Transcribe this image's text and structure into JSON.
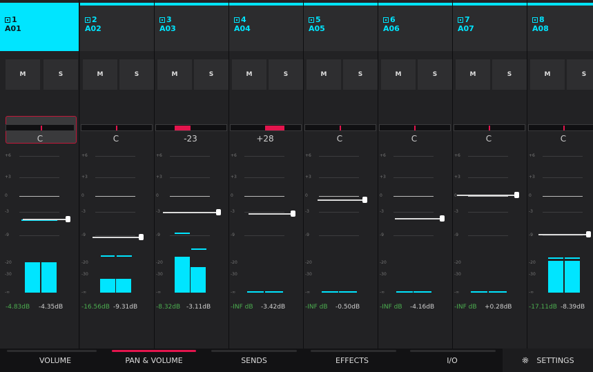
{
  "strips": [
    {
      "num": "1",
      "name": "A01",
      "pan": "C",
      "db_left": "-4.83dB",
      "db_right": "-4.35dB",
      "selected": true,
      "pan_type": "center"
    },
    {
      "num": "2",
      "name": "A02",
      "pan": "C",
      "db_left": "-16.56dB",
      "db_right": "-9.31dB",
      "selected": false,
      "pan_type": "center"
    },
    {
      "num": "3",
      "name": "A03",
      "pan": "-23",
      "db_left": "-8.32dB",
      "db_right": "-3.11dB",
      "selected": false,
      "pan_type": "left"
    },
    {
      "num": "4",
      "name": "A04",
      "pan": "+28",
      "db_left": "-INF dB",
      "db_right": "-3.42dB",
      "selected": false,
      "pan_type": "right"
    },
    {
      "num": "5",
      "name": "A05",
      "pan": "C",
      "db_left": "-INF dB",
      "db_right": "-0.50dB",
      "selected": false,
      "pan_type": "center"
    },
    {
      "num": "6",
      "name": "A06",
      "pan": "C",
      "db_left": "-INF dB",
      "db_right": "-4.16dB",
      "selected": false,
      "pan_type": "center"
    },
    {
      "num": "7",
      "name": "A07",
      "pan": "C",
      "db_left": "-INF dB",
      "db_right": "+0.28dB",
      "selected": false,
      "pan_type": "center"
    },
    {
      "num": "8",
      "name": "A08",
      "pan": "C",
      "db_left": "-17.11dB",
      "db_right": "-8.39dB",
      "selected": false,
      "pan_type": "center"
    }
  ],
  "mute_label": "M",
  "solo_label": "S",
  "scale_labels": [
    "+6",
    "+3",
    "0",
    "-3",
    "-9",
    "-20",
    "-30",
    "-∞"
  ],
  "tabs": {
    "volume": "VOLUME",
    "pan_volume": "PAN & VOLUME",
    "sends": "SENDS",
    "effects": "EFFECTS",
    "io": "I/O",
    "settings": "SETTINGS"
  },
  "active_tab": "pan_volume",
  "colors": {
    "accent": "#00e5ff",
    "pan": "#e3154d",
    "db_left": "#4caf50"
  },
  "icons": {
    "track": "track-icon",
    "settings": "gear-icon"
  }
}
